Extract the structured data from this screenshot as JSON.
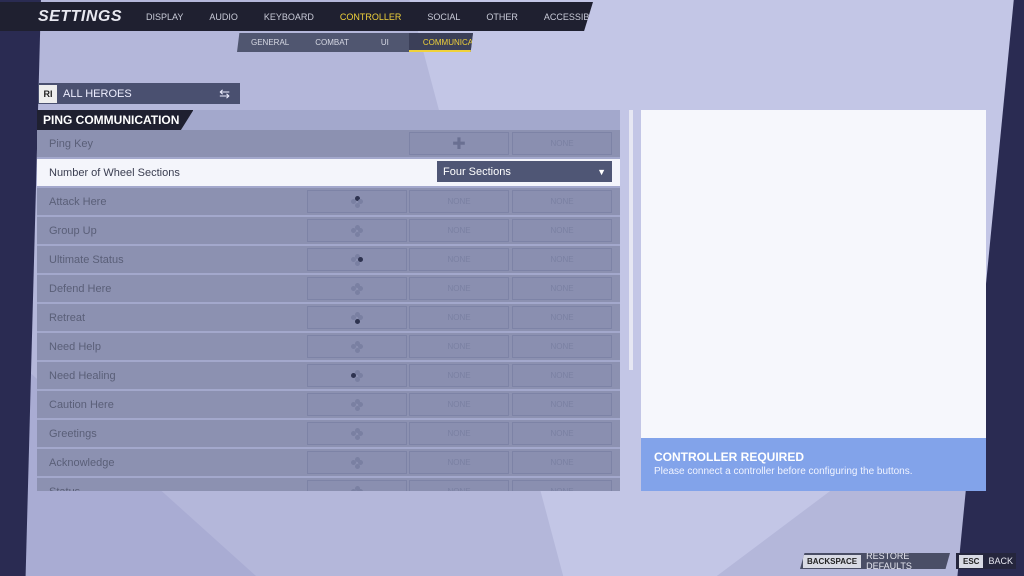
{
  "header": {
    "title": "SETTINGS",
    "tabs": [
      {
        "label": "DISPLAY",
        "active": false
      },
      {
        "label": "AUDIO",
        "active": false
      },
      {
        "label": "KEYBOARD",
        "active": false
      },
      {
        "label": "CONTROLLER",
        "active": true
      },
      {
        "label": "SOCIAL",
        "active": false
      },
      {
        "label": "OTHER",
        "active": false
      },
      {
        "label": "ACCESSIBILITY",
        "active": false
      }
    ],
    "subtabs": [
      {
        "label": "GENERAL",
        "active": false
      },
      {
        "label": "COMBAT",
        "active": false
      },
      {
        "label": "UI",
        "active": false
      },
      {
        "label": "COMMUNICATION",
        "active": true
      }
    ]
  },
  "hero_selector": {
    "label": "ALL HEROES",
    "icon": "swap-icon"
  },
  "section": {
    "title": "PING COMMUNICATION"
  },
  "ping_key": {
    "label": "Ping Key",
    "binding_icon": "dpad-icon",
    "binding2": "NONE"
  },
  "wheel": {
    "label": "Number of Wheel Sections",
    "value": "Four Sections"
  },
  "rows": [
    {
      "label": "Attack Here",
      "highlight": "top",
      "b2": "NONE",
      "b3": "NONE"
    },
    {
      "label": "Group Up",
      "highlight": "none",
      "b2": "NONE",
      "b3": "NONE"
    },
    {
      "label": "Ultimate Status",
      "highlight": "right",
      "b2": "NONE",
      "b3": "NONE"
    },
    {
      "label": "Defend Here",
      "highlight": "none",
      "b2": "NONE",
      "b3": "NONE"
    },
    {
      "label": "Retreat",
      "highlight": "bottom",
      "b2": "NONE",
      "b3": "NONE"
    },
    {
      "label": "Need Help",
      "highlight": "none",
      "b2": "NONE",
      "b3": "NONE"
    },
    {
      "label": "Need Healing",
      "highlight": "left",
      "b2": "NONE",
      "b3": "NONE"
    },
    {
      "label": "Caution Here",
      "highlight": "none",
      "b2": "NONE",
      "b3": "NONE"
    },
    {
      "label": "Greetings",
      "highlight": "none",
      "b2": "NONE",
      "b3": "NONE"
    },
    {
      "label": "Acknowledge",
      "highlight": "none",
      "b2": "NONE",
      "b3": "NONE"
    },
    {
      "label": "Status",
      "highlight": "none",
      "b2": "NONE",
      "b3": "NONE"
    }
  ],
  "notice": {
    "title": "CONTROLLER REQUIRED",
    "text": "Please connect a controller before configuring the buttons."
  },
  "footer": {
    "restore_key": "BACKSPACE",
    "restore_label": "RESTORE DEFAULTS",
    "back_key": "ESC",
    "back_label": "BACK"
  },
  "colors": {
    "accent": "#f0d23a",
    "notice": "#82a3ea",
    "dark": "#1f2030"
  }
}
